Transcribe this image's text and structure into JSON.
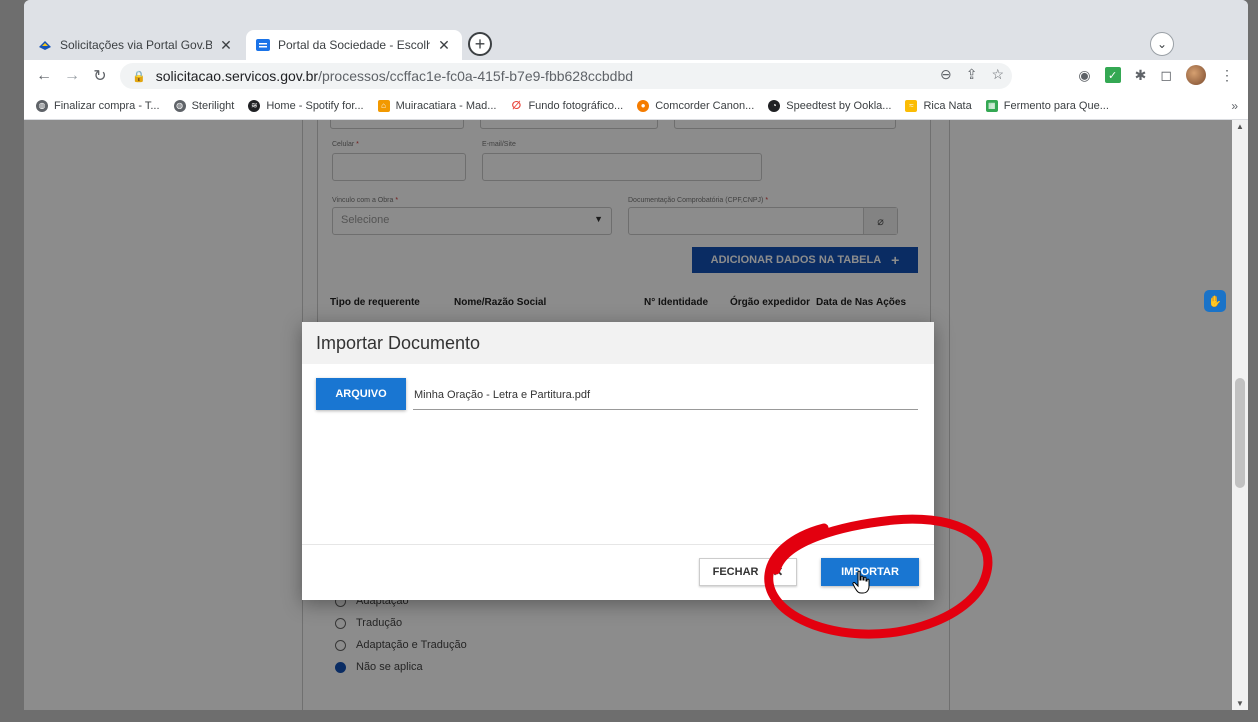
{
  "browser": {
    "tabs": [
      {
        "title": "Solicitações via Portal Gov.Br — F",
        "close": "✕",
        "active": false
      },
      {
        "title": "Portal da Sociedade - Escolher Ti",
        "close": "✕",
        "active": true
      }
    ],
    "new_tab": "+",
    "tab_menu": "⌄",
    "url_host": "solicitacao.servicos.gov.br",
    "url_path": "/processos/ccffac1e-fc0a-415f-b7e9-fbb628ccbdbd",
    "bookmarks": [
      {
        "label": "Finalizar compra - T...",
        "color": "#5f6368"
      },
      {
        "label": "Sterilight",
        "color": "#5f6368"
      },
      {
        "label": "Home - Spotify for...",
        "color": "#202124"
      },
      {
        "label": "Muiracatiara - Mad...",
        "color": "#f29900"
      },
      {
        "label": "Fundo fotográfico...",
        "color": "#e8453c"
      },
      {
        "label": "Comcorder Canon...",
        "color": "#f57c00"
      },
      {
        "label": "Speedtest by Ookla...",
        "color": "#202124"
      },
      {
        "label": "Rica Nata",
        "color": "#fbbc04"
      },
      {
        "label": "Fermento para Que...",
        "color": "#34a853"
      }
    ],
    "bookmarks_more": "»"
  },
  "form": {
    "celular_label": "Celular",
    "email_label": "E-mail/Site",
    "vinculo_label": "Vinculo com a Obra",
    "vinculo_placeholder": "Selecione",
    "doc_label": "Documentação Comprobatória (CPF,CNPJ)",
    "required_mark": "*",
    "add_button": "ADICIONAR DADOS NA TABELA",
    "add_icon": "+",
    "table_headers": [
      "Tipo de requerente",
      "Nome/Razão Social",
      "N° Identidade",
      "Órgão expedidor",
      "Data de Nas",
      "Ações"
    ],
    "radio_options": [
      {
        "label": "Adaptação",
        "selected": false
      },
      {
        "label": "Tradução",
        "selected": false
      },
      {
        "label": "Adaptação e Tradução",
        "selected": false
      },
      {
        "label": "Não se aplica",
        "selected": true
      }
    ]
  },
  "modal": {
    "title": "Importar Documento",
    "arquivo_button": "ARQUIVO",
    "file_name": "Minha Oração - Letra e Partitura.pdf",
    "fechar_button": "FECHAR",
    "fechar_icon": "✕",
    "importar_button": "IMPORTAR"
  },
  "colors": {
    "gov_blue": "#1351b4",
    "button_blue": "#1976d2",
    "annotation_red": "#e3000f"
  }
}
